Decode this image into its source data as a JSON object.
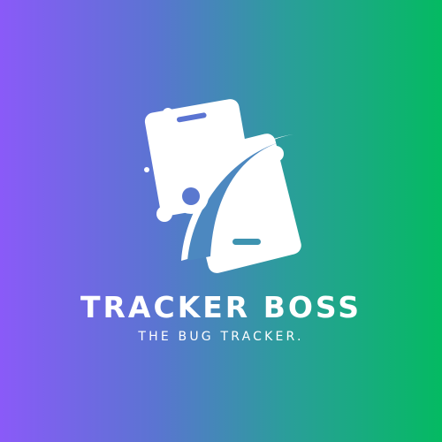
{
  "background": {
    "gradient_start": "#8A5AF8",
    "gradient_end": "#04BA62"
  },
  "logo": {
    "icon": "phone-bug-icon",
    "color": "#FFFFFF"
  },
  "brand": {
    "title": "TRACKER BOSS",
    "tagline": "THE BUG TRACKER."
  }
}
